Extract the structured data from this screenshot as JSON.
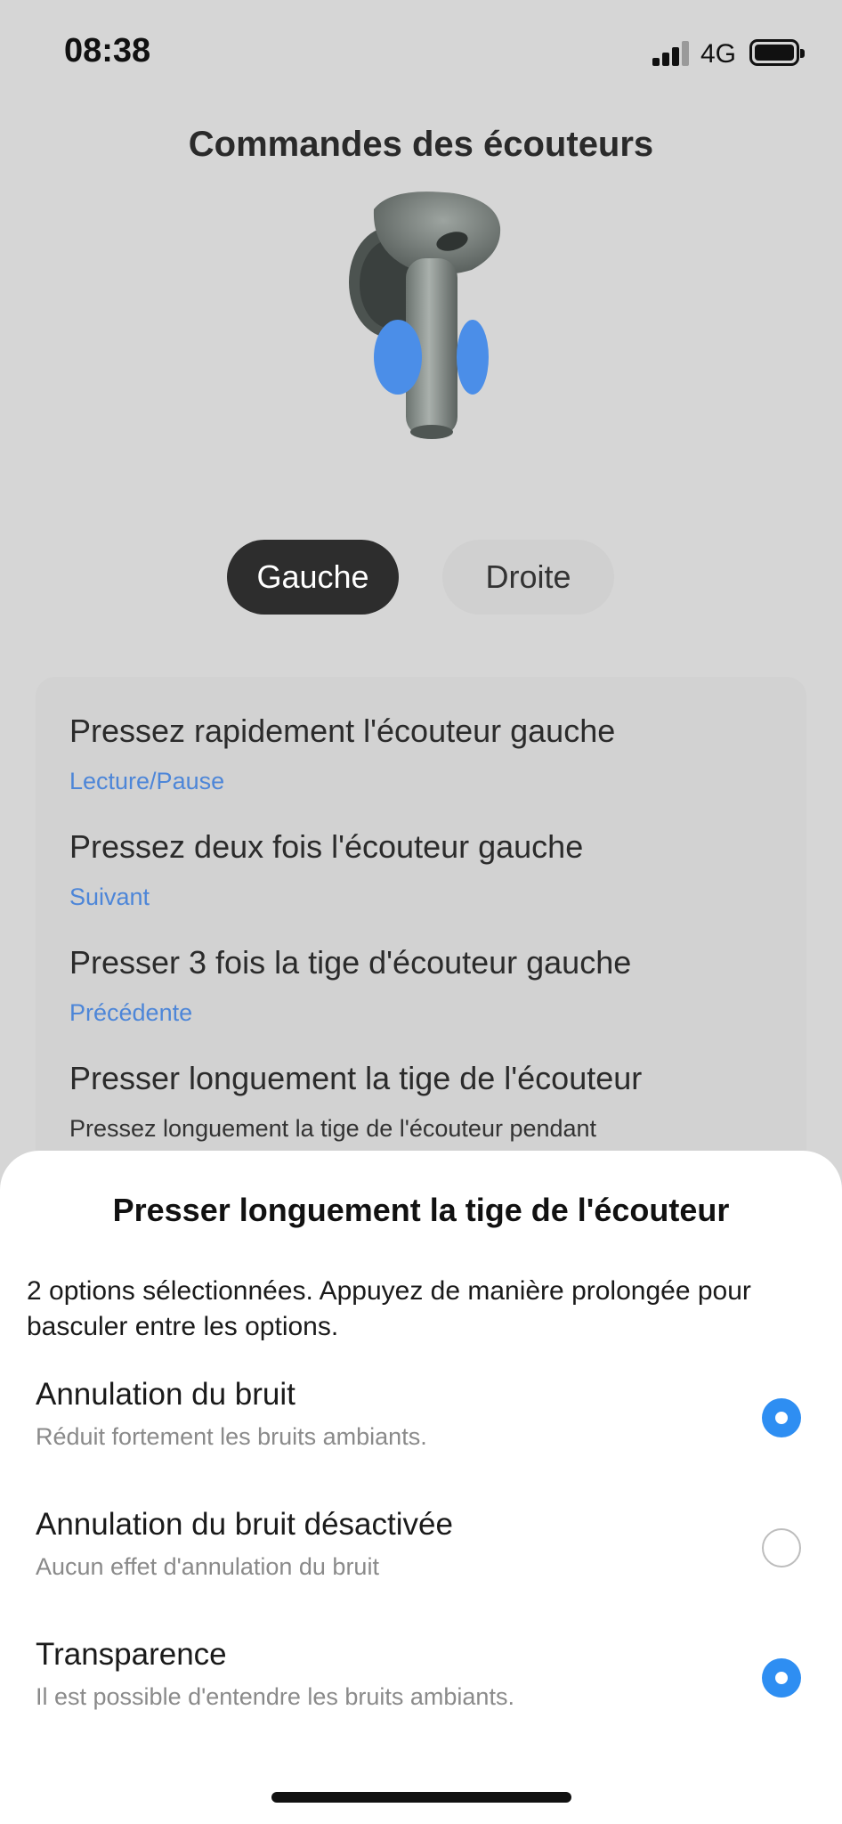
{
  "status_bar": {
    "time": "08:38",
    "network": "4G"
  },
  "page": {
    "title": "Commandes des écouteurs"
  },
  "side_selector": {
    "left_label": "Gauche",
    "right_label": "Droite",
    "selected": "Gauche"
  },
  "settings": [
    {
      "title": "Pressez rapidement l'écouteur gauche",
      "value": "Lecture/Pause"
    },
    {
      "title": "Pressez deux fois l'écouteur gauche",
      "value": "Suivant"
    },
    {
      "title": "Presser 3 fois la tige d'écouteur gauche",
      "value": "Précédente"
    },
    {
      "title": "Presser longuement la tige de l'écouteur",
      "description": "Pressez longuement la tige de l'écouteur pendant"
    }
  ],
  "sheet": {
    "title": "Presser longuement la tige de l'écouteur",
    "description": "2 options sélectionnées. Appuyez de manière prolongée pour basculer entre les options.",
    "options": [
      {
        "label": "Annulation du bruit",
        "sublabel": "Réduit fortement les bruits ambiants.",
        "selected": true
      },
      {
        "label": "Annulation du bruit désactivée",
        "sublabel": "Aucun effet d'annulation du bruit",
        "selected": false
      },
      {
        "label": "Transparence",
        "sublabel": "Il est possible d'entendre les bruits ambiants.",
        "selected": true
      }
    ]
  },
  "colors": {
    "accent_blue": "#4d86d8",
    "radio_selected": "#2e8ef2",
    "segment_active": "#2d2d2d",
    "touch_area_blue": "#4b8ee8"
  },
  "icons": [
    "signal-icon",
    "battery-icon",
    "earbud-icon",
    "radio-selected-icon",
    "radio-unselected-icon"
  ]
}
